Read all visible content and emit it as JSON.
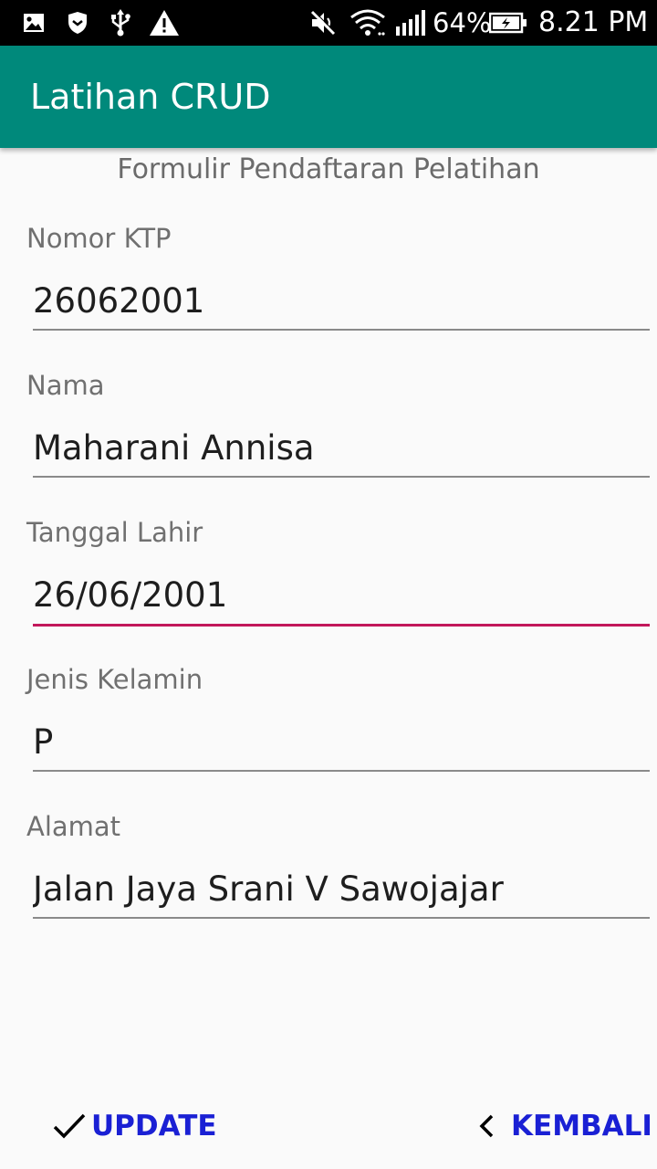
{
  "status_bar": {
    "icons_left": [
      "image-icon",
      "shield-icon",
      "usb-icon",
      "warning-icon"
    ],
    "icons_right": [
      "mute-icon",
      "wifi-icon",
      "signal-icon",
      "battery-charging-icon"
    ],
    "battery_percent": "64%",
    "time": "8.21 PM"
  },
  "app_bar": {
    "title": "Latihan CRUD"
  },
  "form": {
    "heading": "Formulir Pendaftaran Pelatihan",
    "fields": [
      {
        "label": "Nomor KTP",
        "value": "26062001"
      },
      {
        "label": "Nama",
        "value": "Maharani Annisa"
      },
      {
        "label": "Tanggal Lahir",
        "value": "26/06/2001"
      },
      {
        "label": "Jenis Kelamin",
        "value": "P"
      },
      {
        "label": "Alamat",
        "value": "Jalan Jaya Srani V Sawojajar"
      }
    ],
    "focused_field": "Tanggal Lahir"
  },
  "actions": {
    "update": {
      "label": "UPDATE",
      "icon": "check-icon"
    },
    "back": {
      "label": "KEMBALI",
      "icon": "chevron-left-icon"
    }
  },
  "colors": {
    "app_bar": "#00897b",
    "focus_underline": "#c2185b",
    "button_text": "#1a20d4"
  }
}
